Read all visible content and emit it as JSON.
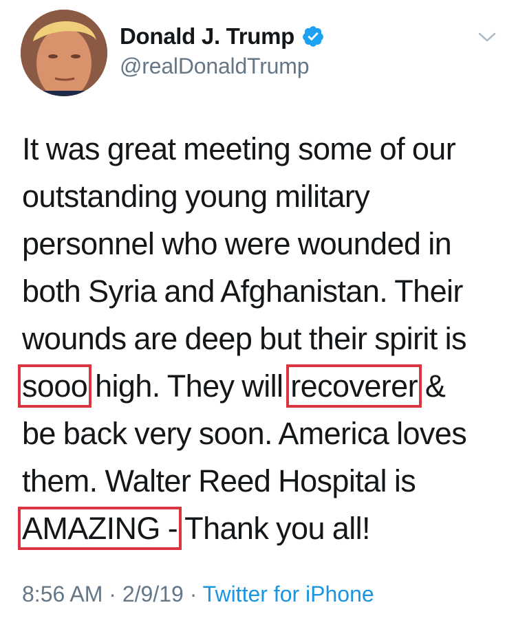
{
  "tweet": {
    "display_name": "Donald J. Trump",
    "handle": "@realDonaldTrump",
    "verified": true,
    "body_lines": [
      "It was great meeting some of our",
      "outstanding young military",
      "personnel who were wounded in",
      "both Syria and Afghanistan. Their",
      "wounds are deep but their spirit is"
    ],
    "line6": {
      "boxed_a": "sooo",
      "mid": " high. They will ",
      "boxed_b": "recoverer",
      "end": " &"
    },
    "line7": "be back very soon. America loves",
    "line8": "them. Walter Reed Hospital is",
    "line9": {
      "boxed": "AMAZING -",
      "end": " Thank you all!"
    },
    "time": "8:56 AM",
    "date": "2/9/19",
    "separator": "·",
    "source": "Twitter for iPhone"
  },
  "colors": {
    "text": "#14171a",
    "secondary": "#657786",
    "link": "#1b95e0",
    "verified_badge": "#1da1f2",
    "highlight_box": "#d9343f"
  },
  "icons": {
    "verified": "verified-badge-icon",
    "menu": "chevron-down-icon"
  }
}
